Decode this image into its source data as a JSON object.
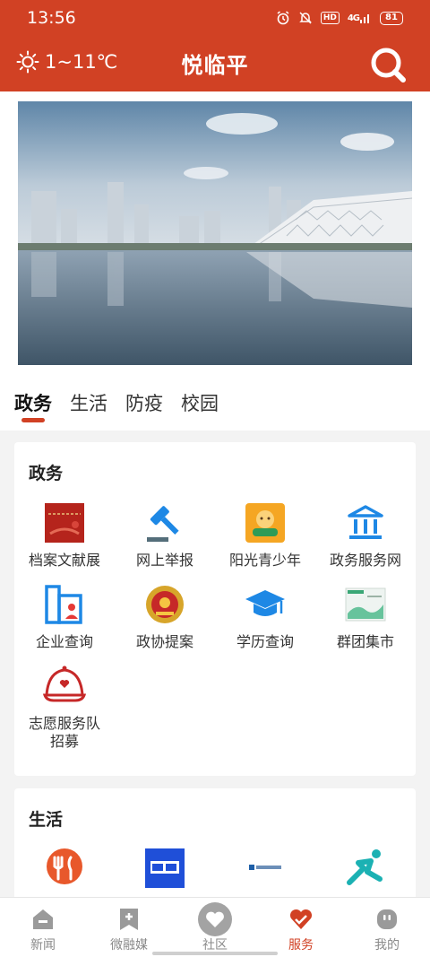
{
  "status_bar": {
    "time": "13:56",
    "hd_label": "HD",
    "signal_label": "4G",
    "battery": "81"
  },
  "header": {
    "weather_text": "1~11℃",
    "title": "悦临平"
  },
  "tabs": [
    {
      "label": "政务",
      "active": true
    },
    {
      "label": "生活",
      "active": false
    },
    {
      "label": "防疫",
      "active": false
    },
    {
      "label": "校园",
      "active": false
    }
  ],
  "sections": {
    "government": {
      "title": "政务",
      "items": [
        {
          "label": "档案文献展",
          "icon": "archive-exhibition-icon"
        },
        {
          "label": "网上举报",
          "icon": "gavel-icon"
        },
        {
          "label": "阳光青少年",
          "icon": "youth-icon"
        },
        {
          "label": "政务服务网",
          "icon": "government-building-icon"
        },
        {
          "label": "企业查询",
          "icon": "enterprise-icon"
        },
        {
          "label": "政协提案",
          "icon": "cppcc-emblem-icon"
        },
        {
          "label": "学历查询",
          "icon": "graduation-cap-icon"
        },
        {
          "label": "群团集市",
          "icon": "market-icon"
        },
        {
          "label": "志愿服务队招募",
          "icon": "volunteer-cap-icon"
        }
      ]
    },
    "life": {
      "title": "生活",
      "items": [
        {
          "label": "",
          "icon": "dining-icon"
        },
        {
          "label": "",
          "icon": "catering-icon"
        },
        {
          "label": "",
          "icon": "environment-icon"
        },
        {
          "label": "",
          "icon": "sports-icon"
        }
      ]
    }
  },
  "bottom_nav": [
    {
      "label": "新闻",
      "icon": "news-icon",
      "active": false
    },
    {
      "label": "微融媒",
      "icon": "bookmark-plus-icon",
      "active": false
    },
    {
      "label": "社区",
      "icon": "community-heart-icon",
      "active": false
    },
    {
      "label": "服务",
      "icon": "service-heart-icon",
      "active": true
    },
    {
      "label": "我的",
      "icon": "profile-icon",
      "active": false
    }
  ],
  "colors": {
    "brand": "#d14124",
    "inactive_nav": "#8a8a8a"
  }
}
